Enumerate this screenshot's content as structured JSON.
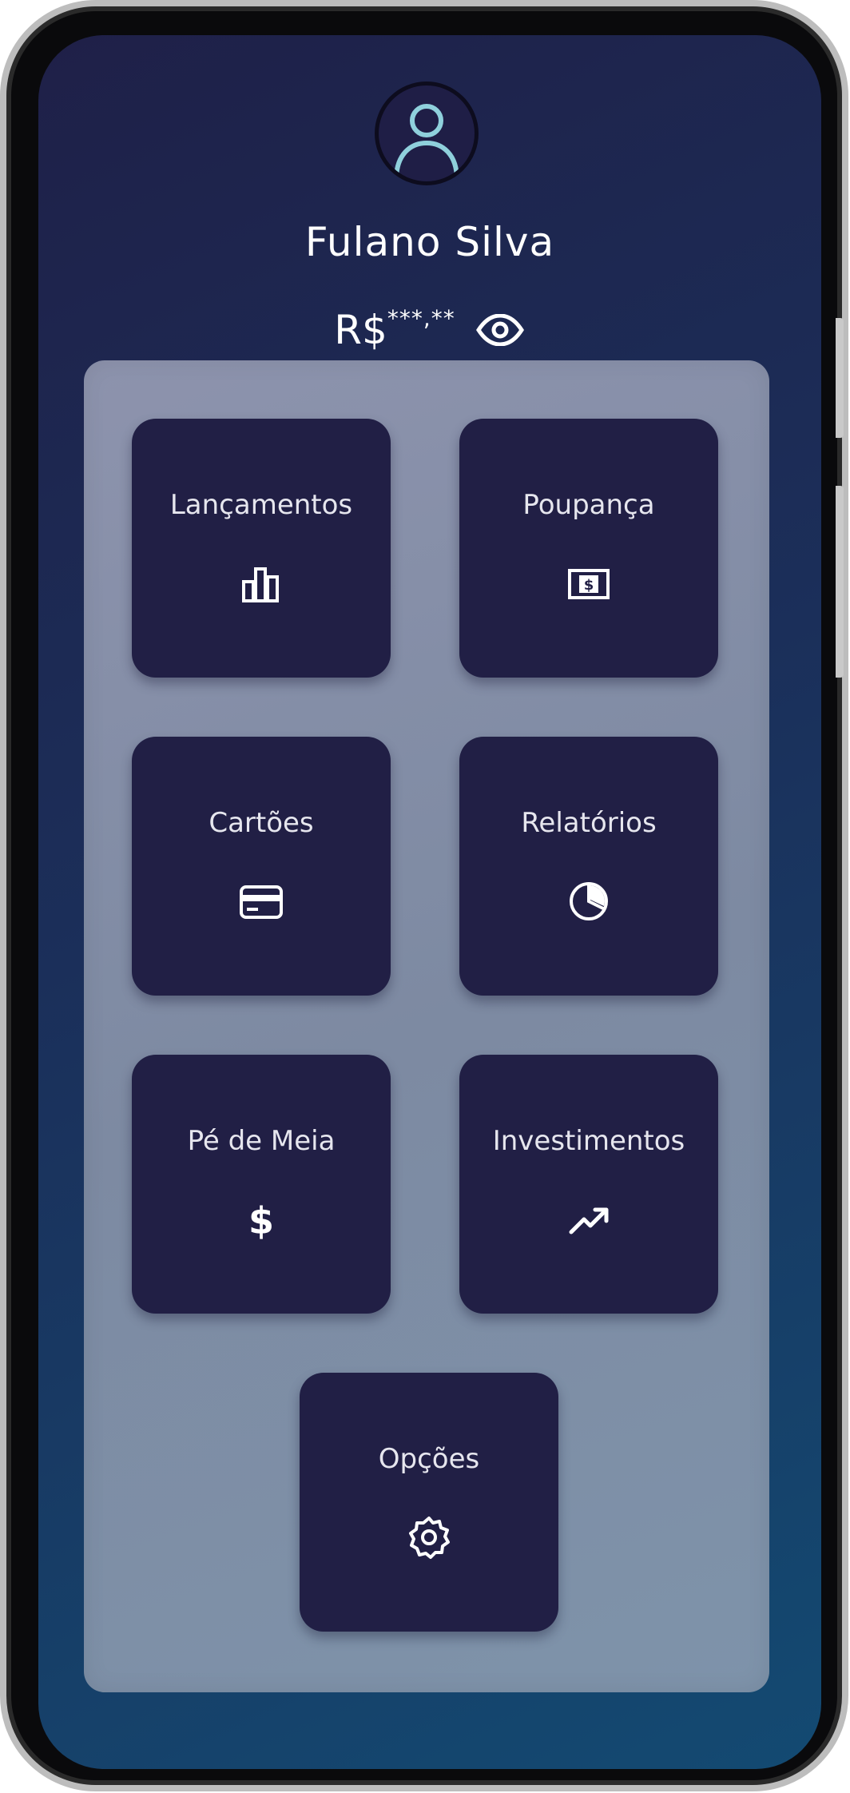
{
  "user": {
    "name": "Fulano Silva",
    "avatar_icon": "user-avatar-icon"
  },
  "balance": {
    "currency": "R$",
    "masked_value": "***,**",
    "toggle_icon": "eye-icon"
  },
  "menu": {
    "items": [
      {
        "label": "Lançamentos",
        "icon": "bar-chart-icon"
      },
      {
        "label": "Poupança",
        "icon": "money-bill-icon"
      },
      {
        "label": "Cartões",
        "icon": "credit-card-icon"
      },
      {
        "label": "Relatórios",
        "icon": "pie-chart-icon"
      },
      {
        "label": "Pé de Meia",
        "icon": "dollar-icon"
      },
      {
        "label": "Investimentos",
        "icon": "trending-up-icon"
      },
      {
        "label": "Opções",
        "icon": "gear-icon"
      }
    ]
  },
  "colors": {
    "background_gradient_start": "#1f2048",
    "background_gradient_end": "#134a72",
    "panel": "#858fa8",
    "tile": "#211f45",
    "text": "#ffffff"
  }
}
